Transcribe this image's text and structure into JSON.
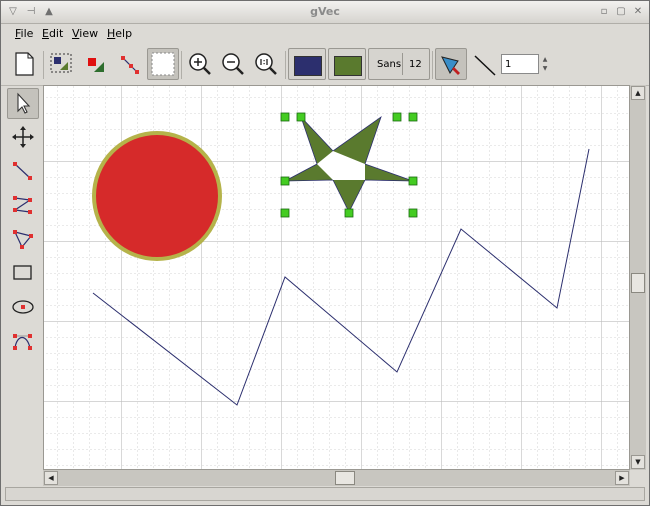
{
  "window": {
    "title": "gVec"
  },
  "menu": [
    {
      "label": "File",
      "mnemonic": "F",
      "rest": "ile"
    },
    {
      "label": "Edit",
      "mnemonic": "E",
      "rest": "dit"
    },
    {
      "label": "View",
      "mnemonic": "V",
      "rest": "iew"
    },
    {
      "label": "Help",
      "mnemonic": "H",
      "rest": "elp"
    }
  ],
  "toolbar": {
    "font_name": "Sans",
    "font_size": "12",
    "line_width": "1",
    "stroke_color": "#2c2f6e",
    "fill_color": "#5a7a2e"
  },
  "tools": [
    "select-tool",
    "move-tool",
    "line-tool",
    "polyline-tool",
    "polygon-tool",
    "rectangle-tool",
    "ellipse-tool",
    "bezier-tool"
  ],
  "colors": {
    "circle_fill": "#d62a2a",
    "circle_stroke": "#b5b34a",
    "star_fill": "#5a7a2e",
    "polyline_stroke": "#2c2f6e",
    "handle": "#44cc22"
  }
}
